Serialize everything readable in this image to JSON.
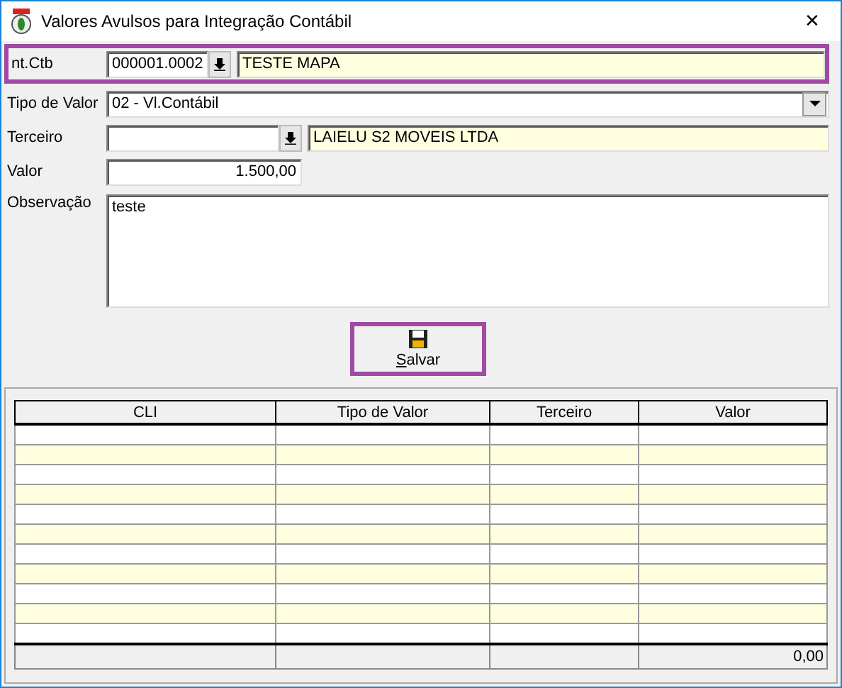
{
  "window": {
    "title": "Valores Avulsos para Integração Contábil",
    "close_glyph": "✕"
  },
  "form": {
    "int_ctb": {
      "label": "nt.Ctb",
      "value": "000001.0002",
      "description": "TESTE MAPA",
      "highlighted": true
    },
    "tipo_valor": {
      "label": "Tipo de Valor",
      "value": "02 - Vl.Contábil"
    },
    "terceiro": {
      "label": "Terceiro",
      "description": "LAIELU S2 MOVEIS LTDA"
    },
    "valor": {
      "label": "Valor",
      "value": "1.500,00"
    },
    "observacao": {
      "label": "Observação",
      "value": "teste"
    }
  },
  "save_button": {
    "mnemonic": "S",
    "rest": "alvar",
    "highlighted": true
  },
  "table": {
    "columns": [
      "CLI",
      "Tipo de Valor",
      "Terceiro",
      "Valor"
    ],
    "footer": {
      "valor_total": "0,00"
    }
  }
}
